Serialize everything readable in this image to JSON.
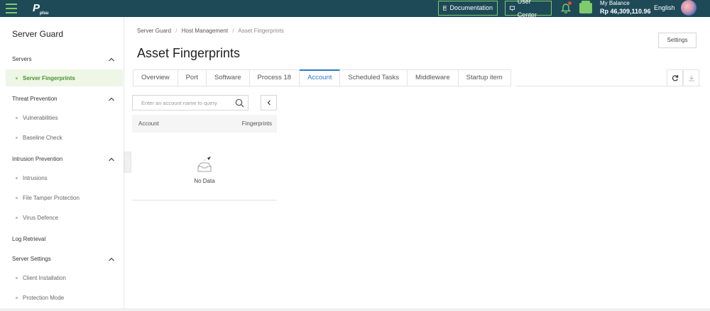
{
  "topbar": {
    "logo_text": "P",
    "logo_sub": "plsu",
    "documentation_label": "Documentation",
    "user_center_label": "User Center",
    "balance_label": "My Balance",
    "balance_amount": "Rp 46,309,110.96",
    "language": "English",
    "accent_color": "#7ecb6b",
    "bar_color": "#1e4a57"
  },
  "sidebar": {
    "title": "Server Guard",
    "groups": {
      "servers": "Servers",
      "threat": "Threat Prevention",
      "intrusion": "Intrusion Prevention",
      "log": "Log Retrieval",
      "settings": "Server Settings"
    },
    "items": {
      "server_fingerprints": "Server Fingerprints",
      "vulnerabilities": "Vulnerabilities",
      "baseline_check": "Baseline Check",
      "intrusions": "Intrusions",
      "file_tamper": "File Tamper Protection",
      "virus_defence": "Virus Defence",
      "client_installation": "Client Installation",
      "protection_mode": "Protection Mode"
    }
  },
  "breadcrumb": {
    "level1": "Server Guard",
    "level2": "Host Management",
    "level3": "Asset Fingerprints",
    "separator": "/"
  },
  "page": {
    "title": "Asset Fingerprints",
    "settings_label": "Settings"
  },
  "tabs": [
    "Overview",
    "Port",
    "Software",
    "Process 18",
    "Account",
    "Scheduled Tasks",
    "Middleware",
    "Startup item"
  ],
  "active_tab": "Account",
  "search": {
    "placeholder": "Enter an account name to query"
  },
  "table": {
    "col_account": "Account",
    "col_fingerprints": "Fingerprints",
    "empty_text": "No Data"
  }
}
